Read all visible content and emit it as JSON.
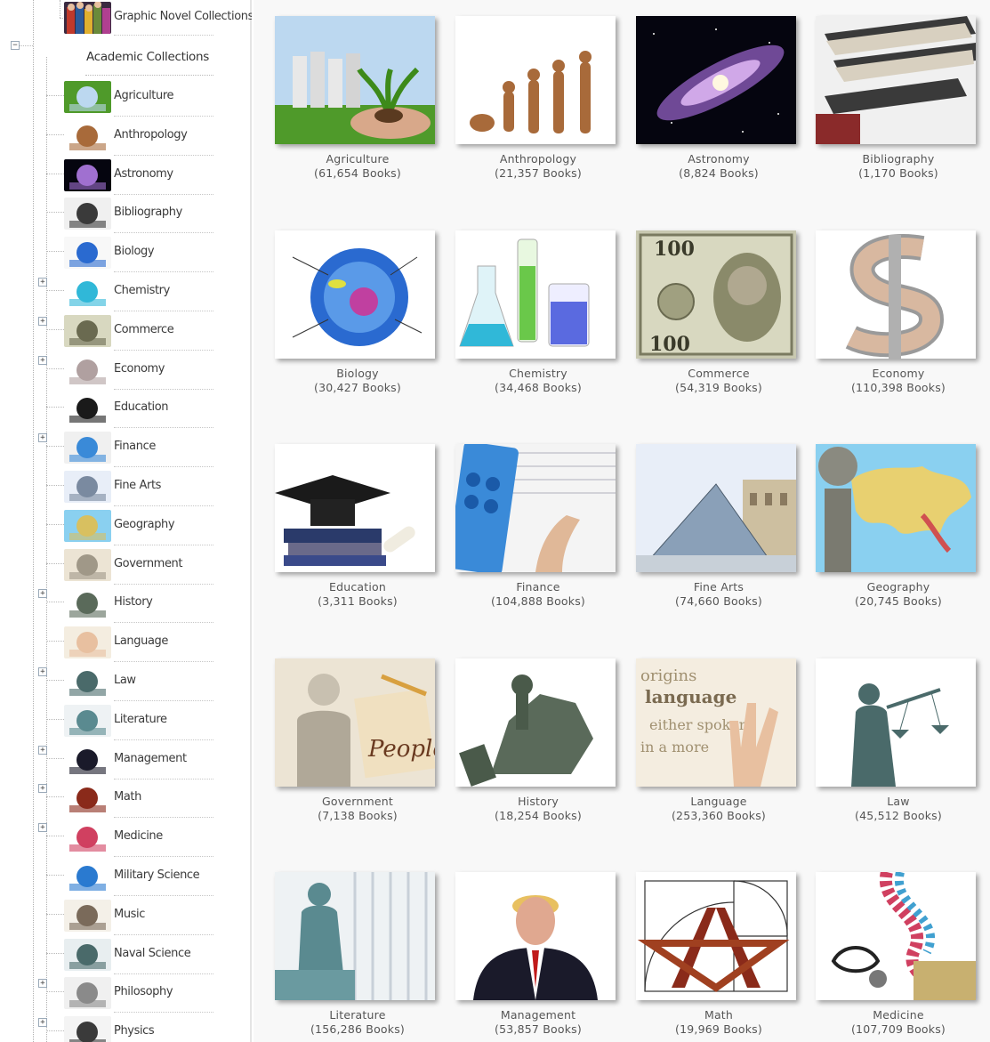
{
  "sidebar": {
    "top_item": {
      "label": "Graphic Novel Collections",
      "icon": "graphic-novel-thumbnail"
    },
    "section_title": "Academic Collections",
    "items": [
      {
        "label": "Agriculture",
        "icon": "agriculture-thumbnail",
        "expandable": false
      },
      {
        "label": "Anthropology",
        "icon": "anthropology-thumbnail",
        "expandable": false
      },
      {
        "label": "Astronomy",
        "icon": "astronomy-thumbnail",
        "expandable": false
      },
      {
        "label": "Bibliography",
        "icon": "bibliography-thumbnail",
        "expandable": false
      },
      {
        "label": "Biology",
        "icon": "biology-thumbnail",
        "expandable": false
      },
      {
        "label": "Chemistry",
        "icon": "chemistry-thumbnail",
        "expandable": true
      },
      {
        "label": "Commerce",
        "icon": "commerce-thumbnail",
        "expandable": true
      },
      {
        "label": "Economy",
        "icon": "economy-thumbnail",
        "expandable": true
      },
      {
        "label": "Education",
        "icon": "education-thumbnail",
        "expandable": false
      },
      {
        "label": "Finance",
        "icon": "finance-thumbnail",
        "expandable": true
      },
      {
        "label": "Fine Arts",
        "icon": "fine-arts-thumbnail",
        "expandable": false
      },
      {
        "label": "Geography",
        "icon": "geography-thumbnail",
        "expandable": false
      },
      {
        "label": "Government",
        "icon": "government-thumbnail",
        "expandable": false
      },
      {
        "label": "History",
        "icon": "history-thumbnail",
        "expandable": true
      },
      {
        "label": "Language",
        "icon": "language-thumbnail",
        "expandable": false
      },
      {
        "label": "Law",
        "icon": "law-thumbnail",
        "expandable": true
      },
      {
        "label": "Literature",
        "icon": "literature-thumbnail",
        "expandable": false
      },
      {
        "label": "Management",
        "icon": "management-thumbnail",
        "expandable": true
      },
      {
        "label": "Math",
        "icon": "math-thumbnail",
        "expandable": true
      },
      {
        "label": "Medicine",
        "icon": "medicine-thumbnail",
        "expandable": true
      },
      {
        "label": "Military Science",
        "icon": "military-science-thumbnail",
        "expandable": false
      },
      {
        "label": "Music",
        "icon": "music-thumbnail",
        "expandable": false
      },
      {
        "label": "Naval Science",
        "icon": "naval-science-thumbnail",
        "expandable": false
      },
      {
        "label": "Philosophy",
        "icon": "philosophy-thumbnail",
        "expandable": true
      },
      {
        "label": "Physics",
        "icon": "physics-thumbnail",
        "expandable": true
      }
    ]
  },
  "grid": {
    "cards": [
      {
        "title": "Agriculture",
        "count": "(61,654 Books)",
        "image": "agriculture-image"
      },
      {
        "title": "Anthropology",
        "count": "(21,357 Books)",
        "image": "anthropology-image"
      },
      {
        "title": "Astronomy",
        "count": "(8,824 Books)",
        "image": "astronomy-image"
      },
      {
        "title": "Bibliography",
        "count": "(1,170 Books)",
        "image": "bibliography-image"
      },
      {
        "title": "Biology",
        "count": "(30,427 Books)",
        "image": "biology-image"
      },
      {
        "title": "Chemistry",
        "count": "(34,468 Books)",
        "image": "chemistry-image"
      },
      {
        "title": "Commerce",
        "count": "(54,319 Books)",
        "image": "commerce-image"
      },
      {
        "title": "Economy",
        "count": "(110,398 Books)",
        "image": "economy-image"
      },
      {
        "title": "Education",
        "count": "(3,311 Books)",
        "image": "education-image"
      },
      {
        "title": "Finance",
        "count": "(104,888 Books)",
        "image": "finance-image"
      },
      {
        "title": "Fine Arts",
        "count": "(74,660 Books)",
        "image": "fine-arts-image"
      },
      {
        "title": "Geography",
        "count": "(20,745 Books)",
        "image": "geography-image"
      },
      {
        "title": "Government",
        "count": "(7,138 Books)",
        "image": "government-image"
      },
      {
        "title": "History",
        "count": "(18,254 Books)",
        "image": "history-image"
      },
      {
        "title": "Language",
        "count": "(253,360 Books)",
        "image": "language-image"
      },
      {
        "title": "Law",
        "count": "(45,512 Books)",
        "image": "law-image"
      },
      {
        "title": "Literature",
        "count": "(156,286 Books)",
        "image": "literature-image"
      },
      {
        "title": "Management",
        "count": "(53,857 Books)",
        "image": "management-image"
      },
      {
        "title": "Math",
        "count": "(19,969 Books)",
        "image": "math-image"
      },
      {
        "title": "Medicine",
        "count": "(107,709 Books)",
        "image": "medicine-image"
      }
    ]
  },
  "colors": {
    "main_background": "#f8f8f8",
    "text": "#555555",
    "tree_line": "#b0b0b0"
  }
}
